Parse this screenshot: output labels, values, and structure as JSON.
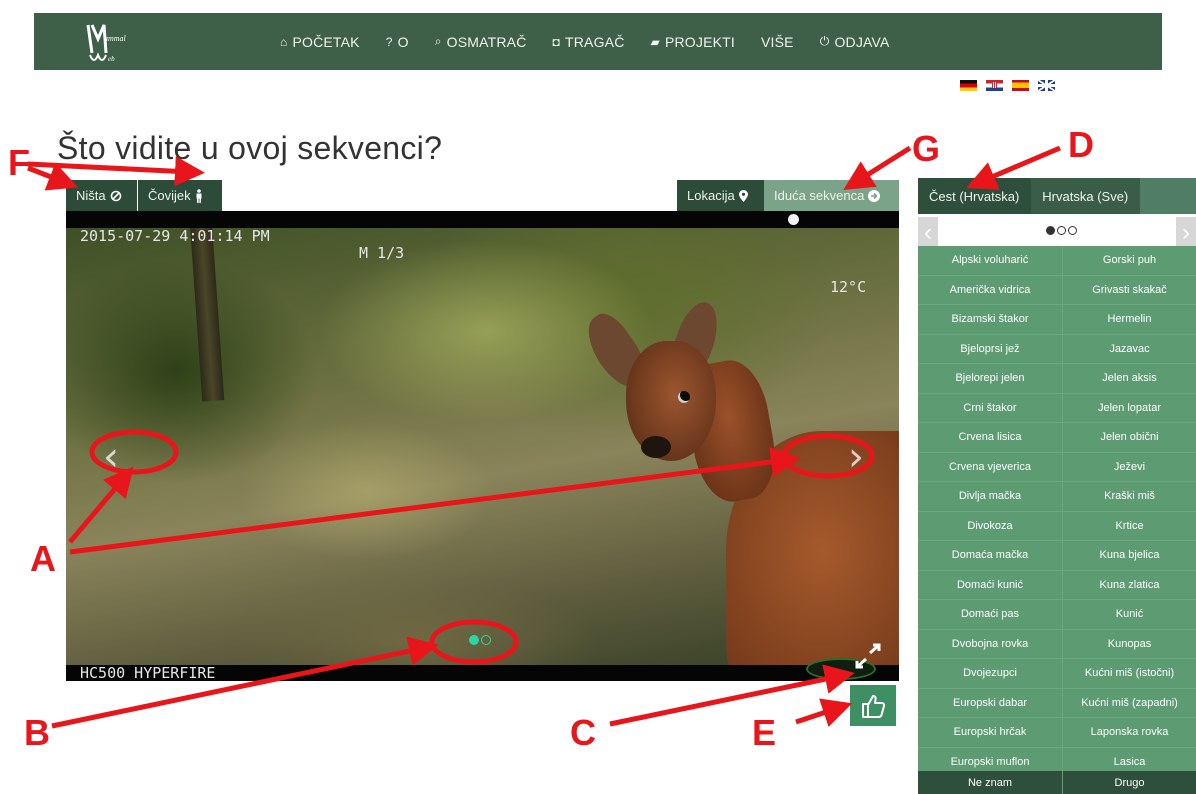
{
  "nav": {
    "items": [
      {
        "icon": "home-icon",
        "glyph": "⌂",
        "label": "POČETAK"
      },
      {
        "icon": "question-icon",
        "glyph": "?",
        "label": "O"
      },
      {
        "icon": "search-icon",
        "glyph": "⌕",
        "label": "OSMATRAČ"
      },
      {
        "icon": "camera-icon",
        "glyph": "◘",
        "label": "TRAGAČ"
      },
      {
        "icon": "book-icon",
        "glyph": "▰",
        "label": "PROJEKTI"
      },
      {
        "icon": "",
        "glyph": "",
        "label": "VIŠE"
      },
      {
        "icon": "power-icon",
        "glyph": "⏻",
        "label": "ODJAVA"
      }
    ],
    "bg_color": "#3e5f48"
  },
  "languages": [
    "de",
    "hr",
    "es",
    "en"
  ],
  "page_title": "Što vidite u ovoj sekvenci?",
  "toolbar": {
    "nista_label": "Ništa",
    "covjek_label": "Čovijek",
    "lokacija_label": "Lokacija",
    "iduca_label": "Iduća sekvenca"
  },
  "image": {
    "osd_date": "2015-07-29 4:01:14 PM",
    "osd_frame": "M 1/3",
    "osd_temp": "12°C",
    "osd_bottom": "HC500 HYPERFIRE",
    "slide_count": 2,
    "active_slide": 1
  },
  "panel": {
    "tabs": [
      {
        "label": "Čest (Hrvatska)",
        "active": true
      },
      {
        "label": "Hrvatska (Sve)",
        "active": false
      }
    ],
    "page_count": 3,
    "active_page": 1,
    "species_left": [
      "Alpski voluharić",
      "Američka vidrica",
      "Bizamski štakor",
      "Bjeloprsi jež",
      "Bjelorepi jelen",
      "Crni štakor",
      "Crvena lisica",
      "Crvena vjeverica",
      "Divlja mačka",
      "Divokoza",
      "Domaća mačka",
      "Domaći kunić",
      "Domaći pas",
      "Dvobojna rovka",
      "Dvojezupci",
      "Europski dabar",
      "Europski hrčak",
      "Europski muflon"
    ],
    "species_right": [
      "Gorski puh",
      "Grivasti skakač",
      "Hermelin",
      "Jazavac",
      "Jelen aksis",
      "Jelen lopatar",
      "Jelen obični",
      "Ježevi",
      "Kraški miš",
      "Krtice",
      "Kuna bjelica",
      "Kuna zlatica",
      "Kunić",
      "Kunopas",
      "Kućni miš (istočni)",
      "Kućni miš (zapadni)",
      "Laponska rovka",
      "Lasica"
    ],
    "footer_left": "Ne znam",
    "footer_right": "Drugo"
  },
  "annotations": {
    "labels": [
      "A",
      "B",
      "C",
      "D",
      "E",
      "F",
      "G"
    ],
    "color": "#e8161b"
  }
}
